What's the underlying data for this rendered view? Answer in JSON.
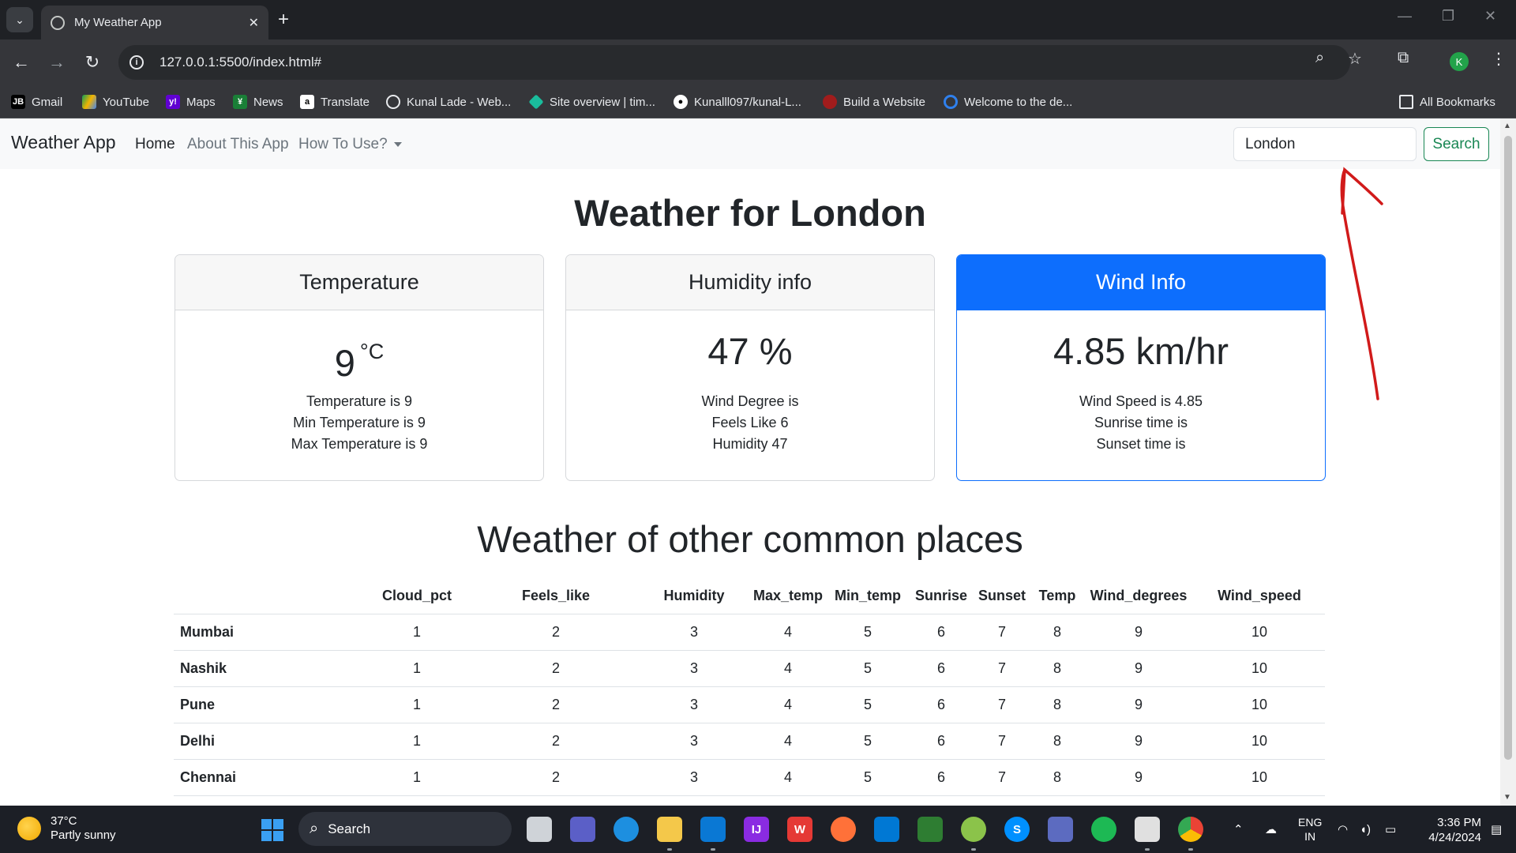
{
  "browser": {
    "tab_title": "My Weather App",
    "url": "127.0.0.1:5500/index.html#",
    "bookmarks": [
      {
        "label": "Gmail",
        "icon": "jetbrains-icon"
      },
      {
        "label": "YouTube",
        "icon": "drive-icon"
      },
      {
        "label": "Maps",
        "icon": "yahoo-icon"
      },
      {
        "label": "News",
        "icon": "news-icon"
      },
      {
        "label": "Translate",
        "icon": "amazon-icon"
      },
      {
        "label": "Kunal Lade - Web...",
        "icon": "globe-icon"
      },
      {
        "label": "Site overview | tim...",
        "icon": "diamond-icon"
      },
      {
        "label": "Kunalll097/kunal-L...",
        "icon": "github-icon"
      },
      {
        "label": "Build a Website",
        "icon": "bird-icon"
      },
      {
        "label": "Welcome to the de...",
        "icon": "loop-icon"
      }
    ],
    "all_bookmarks": "All Bookmarks",
    "profile_initial": "K"
  },
  "nav": {
    "brand": "Weather App",
    "links": [
      "Home",
      "About This App",
      "How To Use?"
    ],
    "search_value": "London",
    "search_button": "Search"
  },
  "page": {
    "heading": "Weather for London",
    "cards": [
      {
        "header": "Temperature",
        "value": "9",
        "unit": "°C",
        "lines": [
          "Temperature is 9",
          "Min Temperature is 9",
          "Max Temperature is 9"
        ]
      },
      {
        "header": "Humidity info",
        "value": "47 %",
        "lines": [
          "Wind Degree is",
          "Feels Like 6",
          "Humidity 47"
        ]
      },
      {
        "header": "Wind Info",
        "value": "4.85 km/hr",
        "lines": [
          "Wind Speed is 4.85",
          "Sunrise time is",
          "Sunset time is"
        ]
      }
    ],
    "subheading": "Weather of other common places",
    "table": {
      "columns": [
        "",
        "Cloud_pct",
        "Feels_like",
        "Humidity",
        "Max_temp",
        "Min_temp",
        "Sunrise",
        "Sunset",
        "Temp",
        "Wind_degrees",
        "Wind_speed"
      ],
      "rows": [
        [
          "Mumbai",
          "1",
          "2",
          "3",
          "4",
          "5",
          "6",
          "7",
          "8",
          "9",
          "10"
        ],
        [
          "Nashik",
          "1",
          "2",
          "3",
          "4",
          "5",
          "6",
          "7",
          "8",
          "9",
          "10"
        ],
        [
          "Pune",
          "1",
          "2",
          "3",
          "4",
          "5",
          "6",
          "7",
          "8",
          "9",
          "10"
        ],
        [
          "Delhi",
          "1",
          "2",
          "3",
          "4",
          "5",
          "6",
          "7",
          "8",
          "9",
          "10"
        ],
        [
          "Chennai",
          "1",
          "2",
          "3",
          "4",
          "5",
          "6",
          "7",
          "8",
          "9",
          "10"
        ]
      ]
    }
  },
  "taskbar": {
    "weather_temp": "37°C",
    "weather_desc": "Partly sunny",
    "search_label": "Search",
    "lang": "ENG",
    "region": "IN",
    "time": "3:36 PM",
    "date": "4/24/2024"
  },
  "colors": {
    "primary": "#0d6efd",
    "success": "#198754",
    "annotation": "#d11a1a"
  }
}
